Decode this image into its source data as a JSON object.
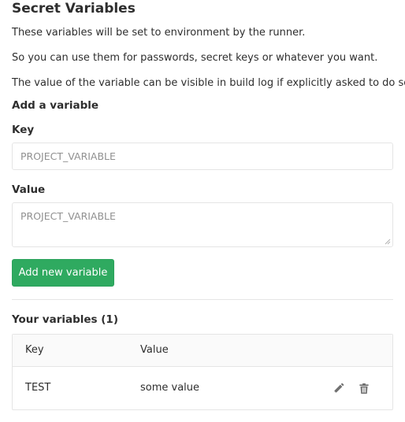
{
  "section": {
    "title": "Secret Variables",
    "descriptions": [
      "These variables will be set to environment by the runner.",
      "So you can use them for passwords, secret keys or whatever you want.",
      "The value of the variable can be visible in build log if explicitly asked to do so."
    ]
  },
  "form": {
    "heading": "Add a variable",
    "key_label": "Key",
    "key_placeholder": "PROJECT_VARIABLE",
    "value_label": "Value",
    "value_placeholder": "PROJECT_VARIABLE",
    "submit_label": "Add new variable"
  },
  "variables": {
    "heading": "Your variables (1)",
    "columns": [
      "Key",
      "Value"
    ],
    "rows": [
      {
        "key": "TEST",
        "value": "some value"
      }
    ],
    "row_actions": [
      "pencil-icon",
      "trash-icon"
    ]
  },
  "colors": {
    "accent": "#2faa60",
    "border": "#e5e5e5",
    "icon": "#707070"
  }
}
